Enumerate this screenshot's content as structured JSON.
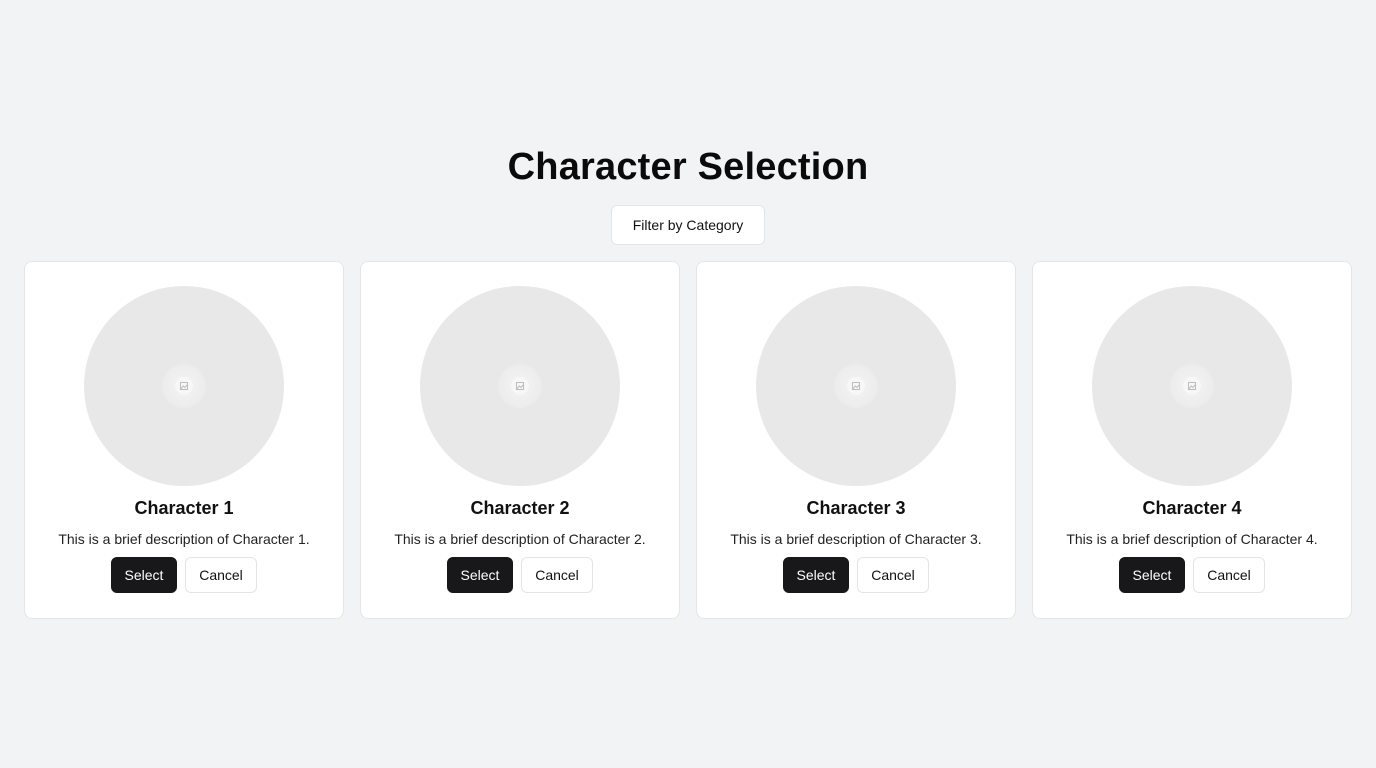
{
  "header": {
    "title": "Character Selection",
    "filter_label": "Filter by Category"
  },
  "characters": [
    {
      "name": "Character 1",
      "description": "This is a brief description of Character 1.",
      "select_label": "Select",
      "cancel_label": "Cancel"
    },
    {
      "name": "Character 2",
      "description": "This is a brief description of Character 2.",
      "select_label": "Select",
      "cancel_label": "Cancel"
    },
    {
      "name": "Character 3",
      "description": "This is a brief description of Character 3.",
      "select_label": "Select",
      "cancel_label": "Cancel"
    },
    {
      "name": "Character 4",
      "description": "This is a brief description of Character 4.",
      "select_label": "Select",
      "cancel_label": "Cancel"
    }
  ],
  "icons": {
    "avatar_placeholder": "image-placeholder-icon"
  },
  "colors": {
    "page_background": "#f2f3f5",
    "card_background": "#ffffff",
    "primary_button": "#18181b",
    "avatar_placeholder": "#e8e8e8"
  }
}
